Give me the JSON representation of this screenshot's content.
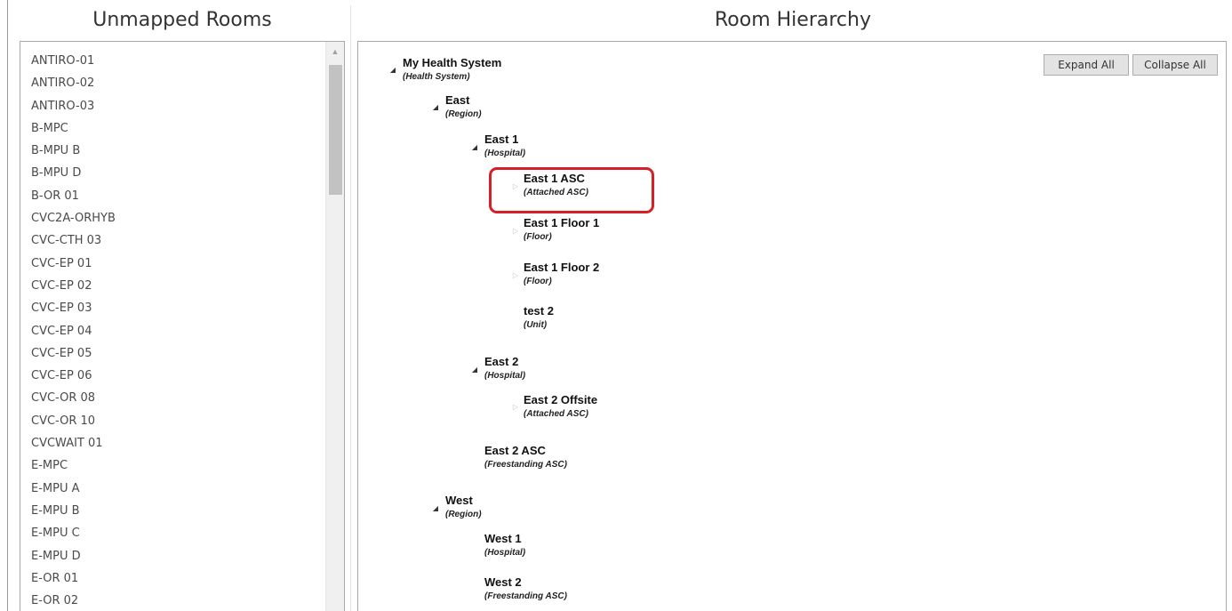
{
  "left_panel": {
    "title": "Unmapped Rooms",
    "rooms": [
      "ANTIRO-01",
      "ANTIRO-02",
      "ANTIRO-03",
      "B-MPC",
      "B-MPU B",
      "B-MPU D",
      "B-OR 01",
      "CVC2A-ORHYB",
      "CVC-CTH 03",
      "CVC-EP 01",
      "CVC-EP 02",
      "CVC-EP 03",
      "CVC-EP 04",
      "CVC-EP 05",
      "CVC-EP 06",
      "CVC-OR 08",
      "CVC-OR 10",
      "CVCWAIT 01",
      "E-MPC",
      "E-MPU A",
      "E-MPU B",
      "E-MPU C",
      "E-MPU D",
      "E-OR 01",
      "E-OR 02"
    ]
  },
  "right_panel": {
    "title": "Room Hierarchy",
    "expand_all_label": "Expand All",
    "collapse_all_label": "Collapse All",
    "highlight_color": "#d61f26",
    "nodes": [
      {
        "name": "My Health System",
        "type": "(Health System)",
        "state": "expanded"
      },
      {
        "name": "East",
        "type": "(Region)",
        "state": "expanded"
      },
      {
        "name": "East 1",
        "type": "(Hospital)",
        "state": "expanded"
      },
      {
        "name": "East 1 ASC",
        "type": "(Attached ASC)",
        "state": "collapsed",
        "highlighted": true
      },
      {
        "name": "East 1 Floor 1",
        "type": "(Floor)",
        "state": "collapsed"
      },
      {
        "name": "East 1 Floor 2",
        "type": "(Floor)",
        "state": "collapsed"
      },
      {
        "name": "test 2",
        "type": "(Unit)",
        "state": "leaf"
      },
      {
        "name": "East 2",
        "type": "(Hospital)",
        "state": "expanded"
      },
      {
        "name": "East 2 Offsite",
        "type": "(Attached ASC)",
        "state": "collapsed"
      },
      {
        "name": "East 2 ASC",
        "type": "(Freestanding ASC)",
        "state": "leaf"
      },
      {
        "name": "West",
        "type": "(Region)",
        "state": "expanded"
      },
      {
        "name": "West 1",
        "type": "(Hospital)",
        "state": "leaf"
      },
      {
        "name": "West 2",
        "type": "(Freestanding ASC)",
        "state": "leaf"
      }
    ]
  }
}
